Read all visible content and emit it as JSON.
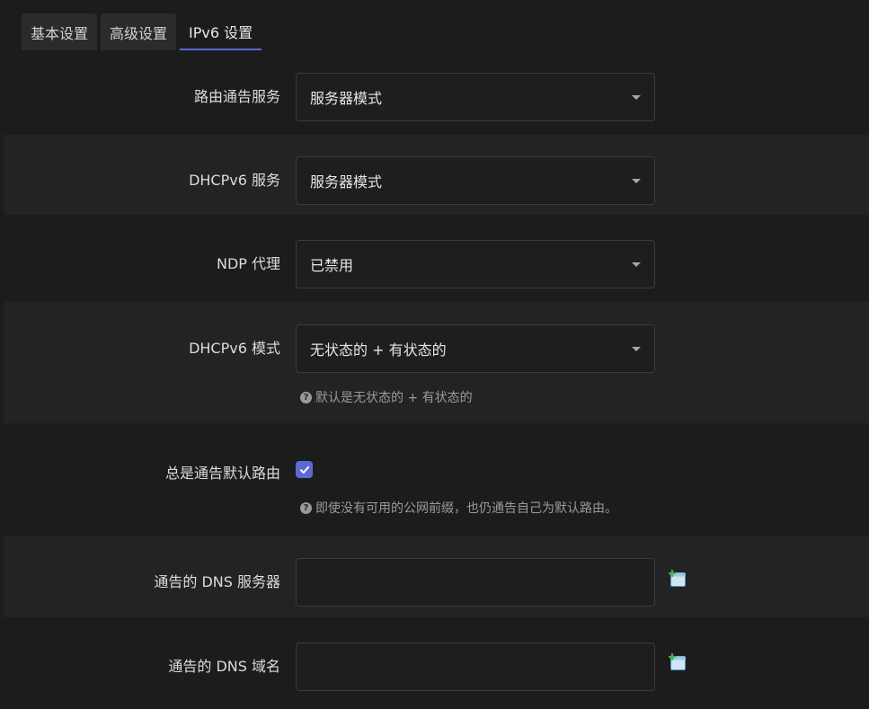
{
  "tabs": [
    {
      "label": "基本设置",
      "active": false
    },
    {
      "label": "高级设置",
      "active": false
    },
    {
      "label": "IPv6 设置",
      "active": true
    }
  ],
  "fields": {
    "ra_service": {
      "label": "路由通告服务",
      "value": "服务器模式"
    },
    "dhcpv6_service": {
      "label": "DHCPv6 服务",
      "value": "服务器模式"
    },
    "ndp_proxy": {
      "label": "NDP 代理",
      "value": "已禁用"
    },
    "dhcpv6_mode": {
      "label": "DHCPv6 模式",
      "value": "无状态的 + 有状态的",
      "help": "默认是无状态的 + 有状态的"
    },
    "always_default_route": {
      "label": "总是通告默认路由",
      "checked": true,
      "help": "即使没有可用的公网前缀，也仍通告自己为默认路由。"
    },
    "ra_dns_servers": {
      "label": "通告的 DNS 服务器",
      "value": ""
    },
    "ra_dns_domains": {
      "label": "通告的 DNS 域名",
      "value": ""
    }
  },
  "icons": {
    "help": "question-circle-icon",
    "add": "add-entry-icon",
    "dropdown": "caret-down-icon",
    "check": "checkmark-icon"
  },
  "colors": {
    "accent": "#5e6ad2",
    "background": "#1c1c1c",
    "row_shade": "#232323"
  }
}
